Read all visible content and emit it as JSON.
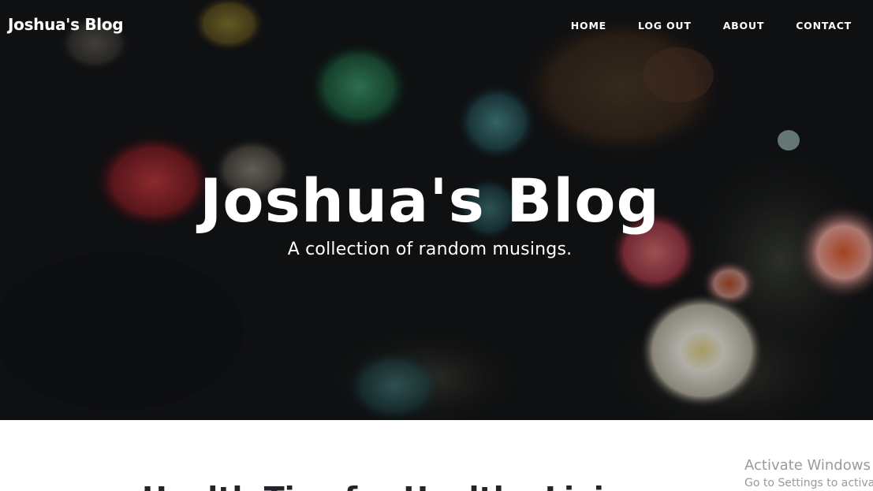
{
  "nav": {
    "brand": "Joshua's Blog",
    "links": [
      "HOME",
      "LOG OUT",
      "ABOUT",
      "CONTACT"
    ]
  },
  "hero": {
    "title": "Joshua's Blog",
    "subtitle": "A collection of random musings."
  },
  "posts": {
    "first_title_partial": "Health Tips for Healthy Living"
  },
  "watermark": {
    "title": "Activate Windows",
    "subtitle": "Go to Settings to activate"
  },
  "colors": {
    "hero_background": "#16181a",
    "nav_text": "#ffffff",
    "watermark_text": "#9a9a9a"
  }
}
